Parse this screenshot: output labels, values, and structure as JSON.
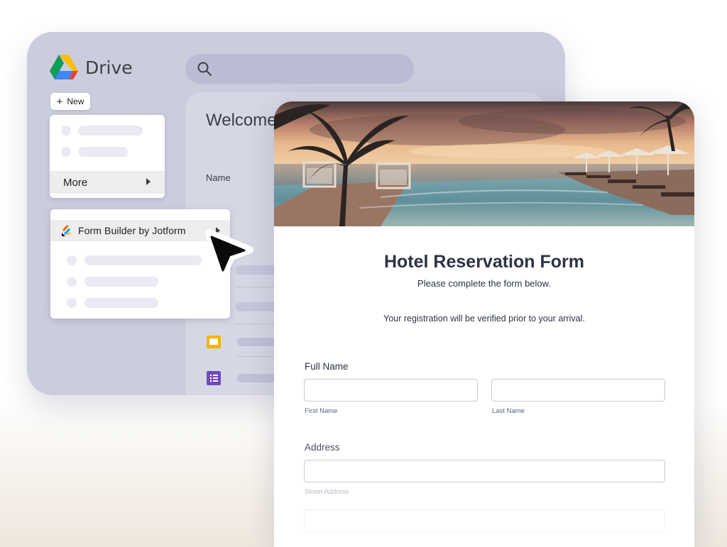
{
  "drive": {
    "app_title": "Drive",
    "search": {
      "placeholder": ""
    },
    "new_button": {
      "icon": "plus-icon",
      "label": "New"
    },
    "context_menu": {
      "more_label": "More"
    },
    "apps_submenu": {
      "item_label": "Form Builder by Jotform",
      "item_icon": "jotform-icon"
    },
    "main": {
      "welcome": "Welcome",
      "column_name": "Name",
      "files": [
        {
          "icon": "slides-icon",
          "color": "#f4b400"
        },
        {
          "icon": "forms-icon",
          "color": "#7248b9"
        }
      ]
    }
  },
  "form": {
    "title": "Hotel Reservation Form",
    "subtitle": "Please complete the form below.",
    "note": "Your registration will be verified prior to your arrival.",
    "full_name": {
      "label": "Full Name",
      "first_sublabel": "First Name",
      "last_sublabel": "Last Name",
      "first_value": "",
      "last_value": ""
    },
    "address": {
      "label": "Address",
      "street_sublabel": "Street Address",
      "street_value": ""
    }
  },
  "colors": {
    "drive_bg": "#cbcddd",
    "form_text": "#2c3345",
    "input_border": "#c3cad8",
    "jotform_orange": "#ff6100",
    "jotform_blue": "#0099ff"
  }
}
